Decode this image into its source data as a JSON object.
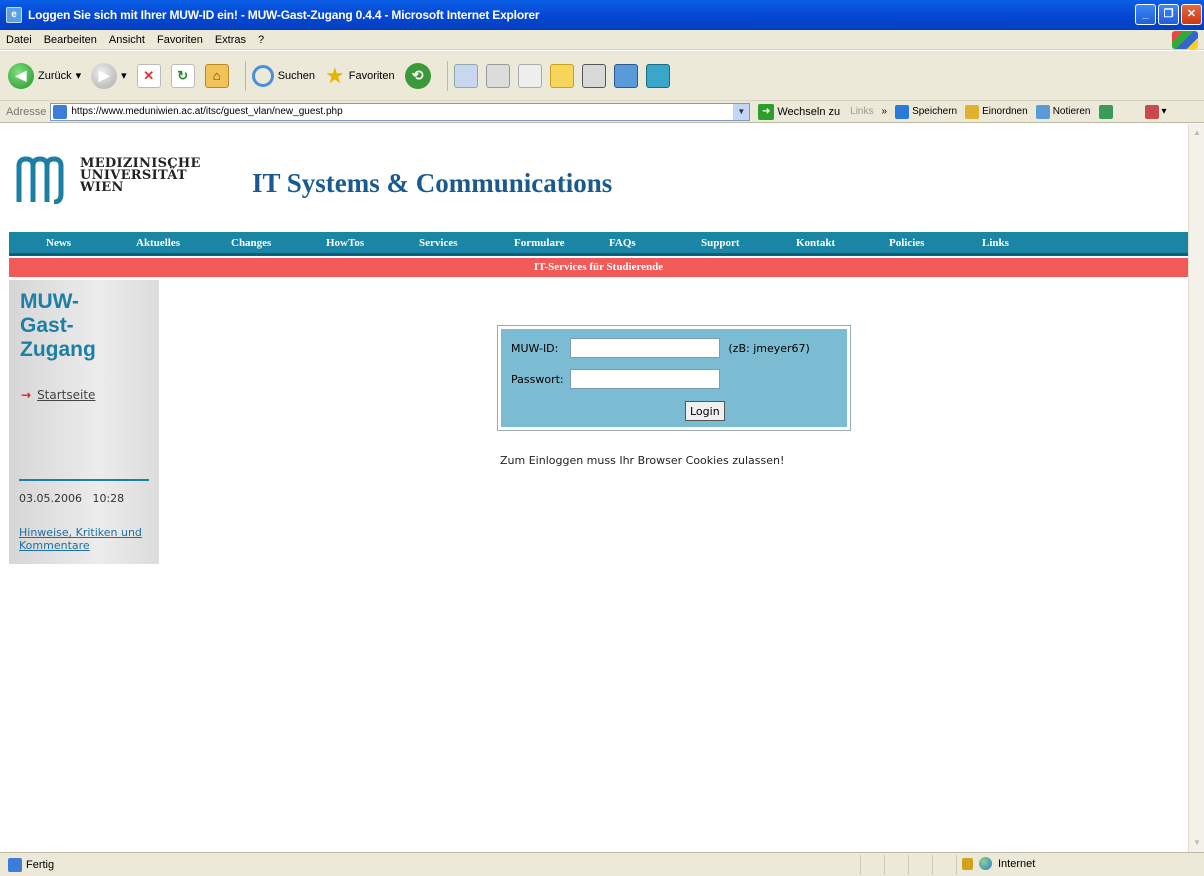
{
  "window": {
    "title": "Loggen Sie sich mit Ihrer MUW-ID ein! - MUW-Gast-Zugang 0.4.4 - Microsoft Internet Explorer"
  },
  "menu": [
    "Datei",
    "Bearbeiten",
    "Ansicht",
    "Favoriten",
    "Extras",
    "?"
  ],
  "toolbar": {
    "back_label": "Zurück",
    "search_label": "Suchen",
    "favorites_label": "Favoriten"
  },
  "address": {
    "label": "Adresse",
    "url": "https://www.meduniwien.ac.at/itsc/guest_vlan/new_guest.php",
    "go_label": "Wechseln zu",
    "links_label": "Links",
    "chevron": "»",
    "links": [
      "Speichern",
      "Einordnen",
      "Notieren"
    ]
  },
  "site": {
    "logo_lines": [
      "MEDIZINISCHE",
      "UNIVERSITÄT",
      "WIEN"
    ],
    "title": "IT Systems & Communications",
    "nav": [
      "News",
      "Aktuelles",
      "Changes",
      "HowTos",
      "Services",
      "Formulare",
      "FAQs",
      "Support",
      "Kontakt",
      "Policies",
      "Links"
    ],
    "subnav": "IT-Services für Studierende"
  },
  "sidebar": {
    "title_lines": [
      "MUW-",
      "Gast-",
      "Zugang"
    ],
    "start_link": "Startseite",
    "datetime": "03.05.2006   10:28",
    "feedback_link": "Hinweise, Kritiken und Kommentare"
  },
  "login": {
    "id_label": "MUW-ID:",
    "id_value": "",
    "id_hint": "(zB: jmeyer67)",
    "password_label": "Passwort:",
    "password_value": "",
    "button_label": "Login",
    "cookie_note": "Zum Einloggen muss Ihr Browser Cookies zulassen!"
  },
  "status": {
    "text": "Fertig",
    "zone": "Internet"
  },
  "colors": {
    "nav_bg": "#1b85a6",
    "subnav_bg": "#f25a5a",
    "login_bg": "#7cbcd3",
    "brand_title": "#1a5a8e"
  }
}
